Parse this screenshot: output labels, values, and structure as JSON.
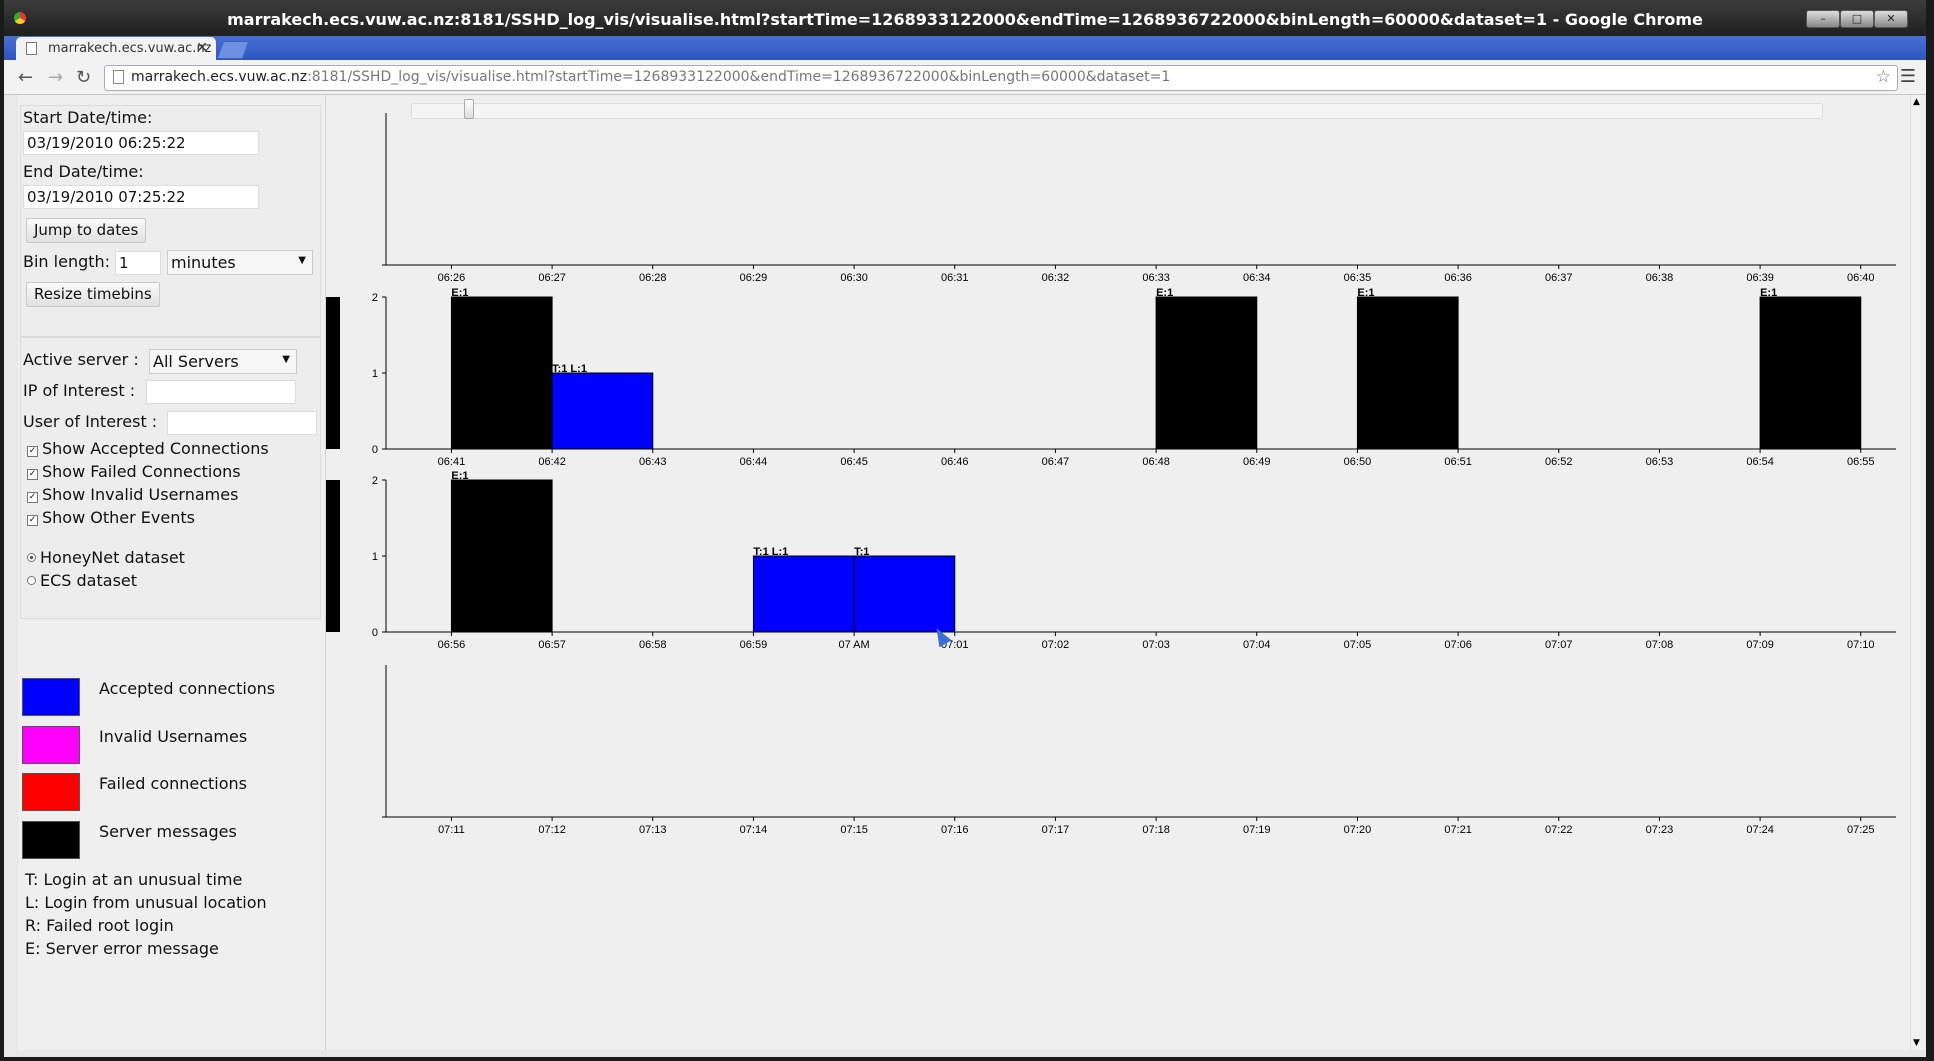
{
  "window": {
    "title": "marrakech.ecs.vuw.ac.nz:8181/SSHD_log_vis/visualise.html?startTime=1268933122000&endTime=1268936722000&binLength=60000&dataset=1 - Google Chrome",
    "min_icon": "minimize-icon",
    "max_icon": "maximize-icon",
    "close_label": "✕"
  },
  "tab": {
    "label": "marrakech.ecs.vuw.ac.nz",
    "close": "✕"
  },
  "address": {
    "host": "marrakech.ecs.vuw.ac.nz",
    "rest": ":8181/SSHD_log_vis/visualise.html?startTime=1268933122000&endTime=1268936722000&binLength=60000&dataset=1"
  },
  "sidebar": {
    "start_label": "Start Date/time:",
    "start_value": "03/19/2010 06:25:22",
    "end_label": "End Date/time:",
    "end_value": "03/19/2010 07:25:22",
    "jump_button": "Jump to dates",
    "bin_label": "Bin length:",
    "bin_value": "1",
    "bin_unit": "minutes",
    "resize_button": "Resize timebins",
    "server_label": "Active server :",
    "server_value": "All Servers",
    "ip_label": "IP of Interest :",
    "ip_value": "",
    "user_label": "User of Interest :",
    "user_value": "",
    "checks": [
      {
        "label": "Show Accepted Connections",
        "checked": true
      },
      {
        "label": "Show Failed Connections",
        "checked": true
      },
      {
        "label": "Show Invalid Usernames",
        "checked": true
      },
      {
        "label": "Show Other Events",
        "checked": true
      }
    ],
    "datasets": [
      {
        "label": "HoneyNet dataset",
        "selected": true
      },
      {
        "label": "ECS dataset",
        "selected": false
      }
    ],
    "legend": [
      {
        "label": "Accepted connections",
        "color": "#0000ff"
      },
      {
        "label": "Invalid Usernames",
        "color": "#ff00ff"
      },
      {
        "label": "Failed connections",
        "color": "#ff0000"
      },
      {
        "label": "Server messages",
        "color": "#000000"
      }
    ],
    "key": [
      "T: Login at an unusual time",
      "L: Login from unusual location",
      "R: Failed root login",
      "E: Server error message"
    ]
  },
  "slider": {
    "value_fraction": 0.037
  },
  "chart_data": [
    {
      "type": "bar",
      "title": "",
      "categories": [
        "06:26",
        "06:27",
        "06:28",
        "06:29",
        "06:30",
        "06:31",
        "06:32",
        "06:33",
        "06:34",
        "06:35",
        "06:36",
        "06:37",
        "06:38",
        "06:39",
        "06:40"
      ],
      "ylim": [
        0,
        2
      ],
      "yticks": [],
      "bars": []
    },
    {
      "type": "bar",
      "title": "",
      "categories": [
        "06:41",
        "06:42",
        "06:43",
        "06:44",
        "06:45",
        "06:46",
        "06:47",
        "06:48",
        "06:49",
        "06:50",
        "06:51",
        "06:52",
        "06:53",
        "06:54",
        "06:55"
      ],
      "ylim": [
        0,
        2
      ],
      "yticks": [
        "0",
        "1",
        "2"
      ],
      "bars": [
        {
          "start": "06:41",
          "end": "06:42",
          "value": 2,
          "color": "#000000",
          "label": "E:1"
        },
        {
          "start": "06:42",
          "end": "06:43",
          "value": 1,
          "color": "#0000ff",
          "label": "T:1 L:1"
        },
        {
          "start": "06:48",
          "end": "06:49",
          "value": 2,
          "color": "#000000",
          "label": "E:1"
        },
        {
          "start": "06:50",
          "end": "06:51",
          "value": 2,
          "color": "#000000",
          "label": "E:1"
        },
        {
          "start": "06:54",
          "end": "06:55",
          "value": 2,
          "color": "#000000",
          "label": "E:1"
        }
      ]
    },
    {
      "type": "bar",
      "title": "",
      "categories": [
        "06:56",
        "06:57",
        "06:58",
        "06:59",
        "07 AM",
        "07:01",
        "07:02",
        "07:03",
        "07:04",
        "07:05",
        "07:06",
        "07:07",
        "07:08",
        "07:09",
        "07:10"
      ],
      "ylim": [
        0,
        2
      ],
      "yticks": [
        "0",
        "1",
        "2"
      ],
      "bars": [
        {
          "start": "06:56",
          "end": "06:57",
          "value": 2,
          "color": "#000000",
          "label": "E:1"
        },
        {
          "start": "06:59",
          "end": "07 AM",
          "value": 1,
          "color": "#0000ff",
          "label": "T:1 L:1"
        },
        {
          "start": "07 AM",
          "end": "07:01",
          "value": 1,
          "color": "#0000ff",
          "label": "T:1"
        }
      ]
    },
    {
      "type": "bar",
      "title": "",
      "categories": [
        "07:11",
        "07:12",
        "07:13",
        "07:14",
        "07:15",
        "07:16",
        "07:17",
        "07:18",
        "07:19",
        "07:20",
        "07:21",
        "07:22",
        "07:23",
        "07:24",
        "07:25"
      ],
      "ylim": [
        0,
        2
      ],
      "yticks": [],
      "bars": []
    }
  ]
}
